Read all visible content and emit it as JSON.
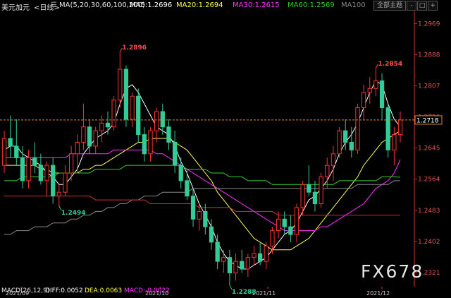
{
  "header": {
    "instrument": "美元加元",
    "period": "<日线>",
    "ma_label": "MA(5,20,30,60,100,200)",
    "ma5": "MA5:1.2696",
    "ma20": "MA20:1.2694",
    "ma30": "MA30:1.2615",
    "ma60": "MA60:1.2569",
    "ma100": "MA100",
    "mode_button": "全部主题",
    "colors": {
      "ma5": "#ffffff",
      "ma20": "#ffff4d",
      "ma30": "#ff33ff",
      "ma60": "#33cc33",
      "ma100": "#888888"
    }
  },
  "footer": {
    "macd_label": "MACD(26,12,9)",
    "diff": "DIFF:0.0052",
    "dea": "DEA:0.0063",
    "macd": "MACD:-0.0022",
    "colors": {
      "diff": "#ffffff",
      "dea": "#ffff4d",
      "macd": "#ff33ff"
    }
  },
  "watermark": "FX678",
  "chart_data": {
    "type": "candlestick",
    "y_ticks": [
      "1.2969",
      "1.2888",
      "1.2807",
      "1.2726",
      "1.2645",
      "1.2564",
      "1.2483",
      "1.2402",
      "1.2321"
    ],
    "ylim": [
      1.2284,
      1.3001
    ],
    "x_labels": [
      "2021/09",
      "2021/10",
      "2021/11",
      "2021/12"
    ],
    "current_price": "1.2718",
    "annotations": [
      "1.2896",
      "1.2854",
      "1.2494",
      "1.2288"
    ],
    "up_color": "#ff3333",
    "down_color": "#33cc99",
    "candles": [
      [
        1.26,
        1.269,
        1.258,
        1.267
      ],
      [
        1.267,
        1.273,
        1.262,
        1.265
      ],
      [
        1.265,
        1.272,
        1.26,
        1.262
      ],
      [
        1.262,
        1.265,
        1.254,
        1.256
      ],
      [
        1.256,
        1.264,
        1.254,
        1.262
      ],
      [
        1.262,
        1.266,
        1.258,
        1.26
      ],
      [
        1.26,
        1.263,
        1.255,
        1.256
      ],
      [
        1.256,
        1.261,
        1.252,
        1.26
      ],
      [
        1.26,
        1.262,
        1.25,
        1.252
      ],
      [
        1.252,
        1.255,
        1.2494,
        1.253
      ],
      [
        1.253,
        1.26,
        1.252,
        1.258
      ],
      [
        1.258,
        1.265,
        1.256,
        1.263
      ],
      [
        1.263,
        1.268,
        1.258,
        1.266
      ],
      [
        1.266,
        1.276,
        1.264,
        1.27
      ],
      [
        1.27,
        1.272,
        1.263,
        1.265
      ],
      [
        1.265,
        1.27,
        1.263,
        1.269
      ],
      [
        1.269,
        1.273,
        1.266,
        1.271
      ],
      [
        1.271,
        1.274,
        1.268,
        1.27
      ],
      [
        1.27,
        1.278,
        1.269,
        1.277
      ],
      [
        1.277,
        1.2896,
        1.275,
        1.285
      ],
      [
        1.285,
        1.286,
        1.27,
        1.272
      ],
      [
        1.272,
        1.279,
        1.27,
        1.278
      ],
      [
        1.278,
        1.28,
        1.266,
        1.268
      ],
      [
        1.268,
        1.27,
        1.261,
        1.263
      ],
      [
        1.263,
        1.27,
        1.261,
        1.269
      ],
      [
        1.269,
        1.275,
        1.266,
        1.274
      ],
      [
        1.274,
        1.276,
        1.268,
        1.27
      ],
      [
        1.27,
        1.272,
        1.264,
        1.266
      ],
      [
        1.266,
        1.269,
        1.258,
        1.26
      ],
      [
        1.26,
        1.262,
        1.254,
        1.256
      ],
      [
        1.256,
        1.259,
        1.251,
        1.252
      ],
      [
        1.252,
        1.254,
        1.244,
        1.246
      ],
      [
        1.246,
        1.25,
        1.243,
        1.248
      ],
      [
        1.248,
        1.25,
        1.242,
        1.244
      ],
      [
        1.244,
        1.246,
        1.238,
        1.24
      ],
      [
        1.24,
        1.242,
        1.233,
        1.235
      ],
      [
        1.235,
        1.238,
        1.232,
        1.236
      ],
      [
        1.236,
        1.238,
        1.2288,
        1.232
      ],
      [
        1.232,
        1.237,
        1.23,
        1.235
      ],
      [
        1.235,
        1.238,
        1.232,
        1.233
      ],
      [
        1.233,
        1.237,
        1.231,
        1.236
      ],
      [
        1.236,
        1.239,
        1.234,
        1.237
      ],
      [
        1.237,
        1.24,
        1.234,
        1.235
      ],
      [
        1.235,
        1.24,
        1.233,
        1.239
      ],
      [
        1.239,
        1.244,
        1.237,
        1.243
      ],
      [
        1.243,
        1.248,
        1.241,
        1.246
      ],
      [
        1.246,
        1.248,
        1.242,
        1.244
      ],
      [
        1.244,
        1.247,
        1.24,
        1.242
      ],
      [
        1.242,
        1.25,
        1.24,
        1.249
      ],
      [
        1.249,
        1.256,
        1.247,
        1.255
      ],
      [
        1.255,
        1.26,
        1.252,
        1.253
      ],
      [
        1.253,
        1.256,
        1.248,
        1.25
      ],
      [
        1.25,
        1.258,
        1.249,
        1.257
      ],
      [
        1.257,
        1.262,
        1.254,
        1.26
      ],
      [
        1.26,
        1.265,
        1.256,
        1.263
      ],
      [
        1.263,
        1.27,
        1.262,
        1.269
      ],
      [
        1.269,
        1.272,
        1.264,
        1.266
      ],
      [
        1.266,
        1.27,
        1.262,
        1.264
      ],
      [
        1.264,
        1.276,
        1.263,
        1.275
      ],
      [
        1.275,
        1.281,
        1.272,
        1.279
      ],
      [
        1.279,
        1.283,
        1.276,
        1.28
      ],
      [
        1.28,
        1.2854,
        1.278,
        1.282
      ],
      [
        1.282,
        1.284,
        1.272,
        1.275
      ],
      [
        1.275,
        1.276,
        1.262,
        1.264
      ],
      [
        1.264,
        1.27,
        1.26,
        1.268
      ],
      [
        1.268,
        1.274,
        1.266,
        1.2718
      ]
    ],
    "ma_lines": [
      {
        "name": "MA5",
        "color": "#ffffff",
        "values": [
          1.264,
          1.265,
          1.265,
          1.263,
          1.262,
          1.261,
          1.26,
          1.258,
          1.257,
          1.255,
          1.255,
          1.257,
          1.259,
          1.263,
          1.265,
          1.267,
          1.268,
          1.269,
          1.271,
          1.276,
          1.28,
          1.281,
          1.279,
          1.276,
          1.273,
          1.27,
          1.269,
          1.268,
          1.265,
          1.261,
          1.258,
          1.254,
          1.25,
          1.247,
          1.244,
          1.24,
          1.237,
          1.235,
          1.234,
          1.233,
          1.233,
          1.234,
          1.235,
          1.236,
          1.238,
          1.24,
          1.242,
          1.243,
          1.245,
          1.248,
          1.251,
          1.252,
          1.254,
          1.256,
          1.259,
          1.263,
          1.266,
          1.268,
          1.271,
          1.275,
          1.279,
          1.282,
          1.281,
          1.276,
          1.272,
          1.27
        ]
      },
      {
        "name": "MA20",
        "color": "#ffff4d",
        "values": [
          1.26,
          1.26,
          1.26,
          1.26,
          1.26,
          1.26,
          1.259,
          1.259,
          1.258,
          1.258,
          1.258,
          1.258,
          1.258,
          1.259,
          1.259,
          1.26,
          1.26,
          1.261,
          1.262,
          1.263,
          1.264,
          1.265,
          1.266,
          1.266,
          1.267,
          1.267,
          1.267,
          1.267,
          1.266,
          1.265,
          1.264,
          1.262,
          1.26,
          1.258,
          1.256,
          1.253,
          1.251,
          1.249,
          1.247,
          1.245,
          1.243,
          1.241,
          1.24,
          1.239,
          1.238,
          1.238,
          1.238,
          1.238,
          1.239,
          1.24,
          1.241,
          1.243,
          1.245,
          1.247,
          1.249,
          1.251,
          1.253,
          1.255,
          1.257,
          1.26,
          1.262,
          1.264,
          1.266,
          1.267,
          1.268,
          1.269
        ]
      },
      {
        "name": "MA30",
        "color": "#ff33ff",
        "values": [
          1.262,
          1.262,
          1.262,
          1.262,
          1.262,
          1.262,
          1.262,
          1.262,
          1.262,
          1.262,
          1.262,
          1.263,
          1.263,
          1.263,
          1.263,
          1.263,
          1.263,
          1.263,
          1.264,
          1.264,
          1.264,
          1.264,
          1.264,
          1.264,
          1.264,
          1.263,
          1.263,
          1.262,
          1.261,
          1.26,
          1.259,
          1.258,
          1.257,
          1.256,
          1.255,
          1.254,
          1.253,
          1.252,
          1.251,
          1.25,
          1.249,
          1.248,
          1.247,
          1.246,
          1.245,
          1.244,
          1.243,
          1.243,
          1.243,
          1.243,
          1.243,
          1.243,
          1.244,
          1.244,
          1.245,
          1.246,
          1.247,
          1.248,
          1.249,
          1.25,
          1.252,
          1.254,
          1.255,
          1.256,
          1.258,
          1.2615
        ]
      },
      {
        "name": "MA60",
        "color": "#33cc33",
        "values": [
          1.256,
          1.256,
          1.256,
          1.257,
          1.257,
          1.257,
          1.257,
          1.257,
          1.257,
          1.258,
          1.258,
          1.258,
          1.258,
          1.258,
          1.258,
          1.259,
          1.259,
          1.259,
          1.259,
          1.259,
          1.26,
          1.26,
          1.26,
          1.26,
          1.26,
          1.26,
          1.26,
          1.26,
          1.26,
          1.26,
          1.259,
          1.259,
          1.259,
          1.259,
          1.258,
          1.258,
          1.258,
          1.257,
          1.257,
          1.257,
          1.256,
          1.256,
          1.256,
          1.256,
          1.255,
          1.255,
          1.255,
          1.255,
          1.255,
          1.255,
          1.255,
          1.255,
          1.255,
          1.255,
          1.255,
          1.256,
          1.256,
          1.256,
          1.256,
          1.256,
          1.256,
          1.256,
          1.257,
          1.257,
          1.257,
          1.2569
        ]
      },
      {
        "name": "MA100",
        "color": "#888888",
        "values": [
          1.242,
          1.242,
          1.243,
          1.243,
          1.243,
          1.244,
          1.244,
          1.244,
          1.245,
          1.245,
          1.245,
          1.246,
          1.246,
          1.247,
          1.247,
          1.248,
          1.248,
          1.249,
          1.249,
          1.25,
          1.25,
          1.251,
          1.251,
          1.252,
          1.252,
          1.252,
          1.253,
          1.253,
          1.253,
          1.253,
          1.253,
          1.254,
          1.254,
          1.254,
          1.254,
          1.254,
          1.254,
          1.254,
          1.254,
          1.254,
          1.254,
          1.254,
          1.254,
          1.254,
          1.254,
          1.254,
          1.254,
          1.254,
          1.254,
          1.254,
          1.254,
          1.254,
          1.254,
          1.254,
          1.254,
          1.254,
          1.254,
          1.254,
          1.255,
          1.255,
          1.255,
          1.255,
          1.255,
          1.255,
          1.256,
          1.256
        ]
      },
      {
        "name": "MA200",
        "color": "#cc3333",
        "values": [
          1.252,
          1.252,
          1.252,
          1.252,
          1.252,
          1.252,
          1.252,
          1.252,
          1.252,
          1.252,
          1.252,
          1.252,
          1.252,
          1.252,
          1.252,
          1.251,
          1.251,
          1.251,
          1.251,
          1.251,
          1.251,
          1.251,
          1.251,
          1.251,
          1.25,
          1.25,
          1.25,
          1.25,
          1.25,
          1.25,
          1.25,
          1.25,
          1.249,
          1.249,
          1.249,
          1.249,
          1.249,
          1.249,
          1.248,
          1.248,
          1.248,
          1.248,
          1.248,
          1.248,
          1.248,
          1.247,
          1.247,
          1.247,
          1.247,
          1.247,
          1.247,
          1.247,
          1.247,
          1.247,
          1.247,
          1.247,
          1.247,
          1.247,
          1.247,
          1.247,
          1.247,
          1.247,
          1.247,
          1.247,
          1.247,
          1.247
        ]
      }
    ]
  }
}
